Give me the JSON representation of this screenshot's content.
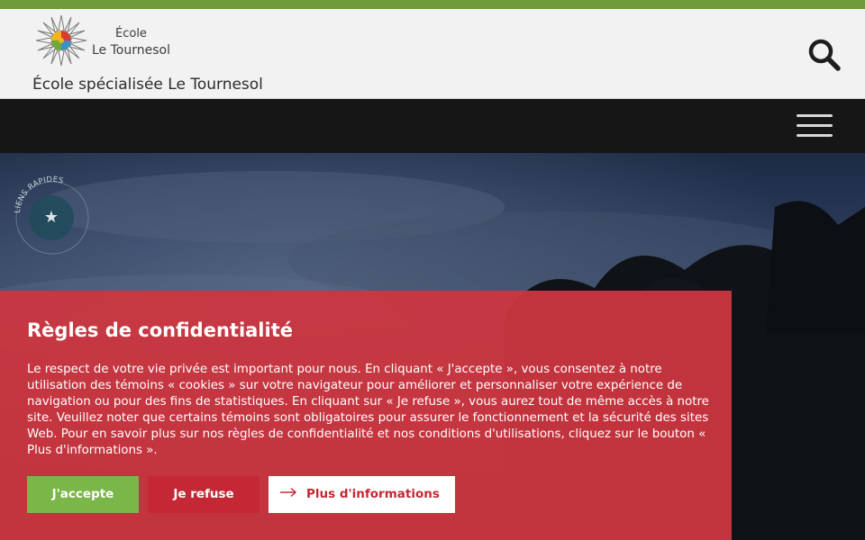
{
  "header": {
    "logo_line1": "École",
    "logo_line2": "Le Tournesol",
    "site_name": "École spécialisée Le Tournesol"
  },
  "icons": {
    "search": "search-icon",
    "menu": "hamburger-menu-icon",
    "quick_links": "star-icon",
    "more_info": "arrow-right-icon"
  },
  "quick_links": {
    "label": "LIENS RAPIDES"
  },
  "cookie_banner": {
    "title": "Règles de confidentialité",
    "text": "Le respect de votre vie privée est important pour nous. En cliquant « J'accepte », vous consentez à notre utilisation des témoins « cookies » sur votre navigateur pour améliorer et personnaliser votre expérience de navigation ou pour des fins de statistiques. En cliquant sur « Je refuse », vous aurez tout de même accès à notre site. Veuillez noter que certains témoins sont obligatoires pour assurer le fonctionnement et la sécurité des sites Web. Pour en savoir plus sur nos règles de confidentialité et nos conditions d'utilisations, cliquez sur le bouton « Plus d'informations ».",
    "accept_label": "J'accepte",
    "refuse_label": "Je refuse",
    "more_label": "Plus d'informations"
  },
  "colors": {
    "topbar": "#6e9a3a",
    "banner": "#cd3640",
    "accept": "#7ab648",
    "refuse": "#c42834",
    "navbar": "#161616"
  }
}
